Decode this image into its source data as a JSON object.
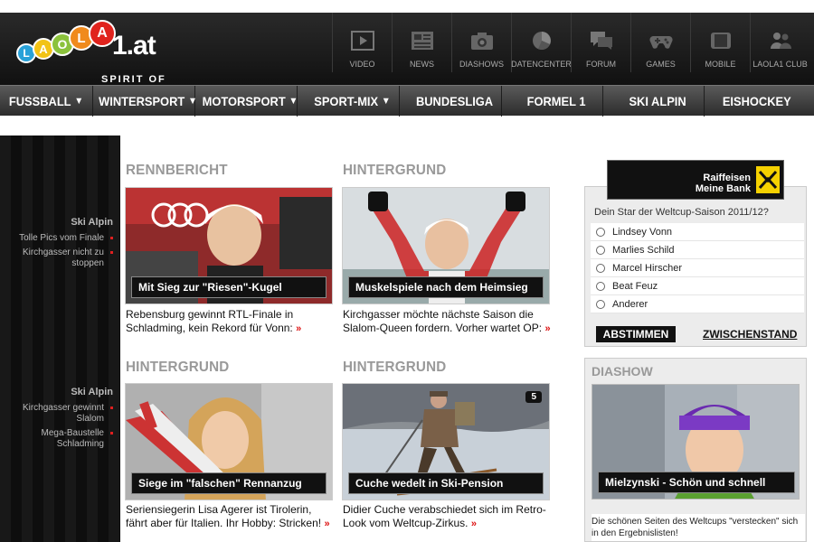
{
  "logo": {
    "balls": [
      "L",
      "A",
      "O",
      "L",
      "A"
    ],
    "suffix": "1.at",
    "tagline": "SPIRIT OF SPORTS"
  },
  "topnav": [
    {
      "label": "VIDEO",
      "icon": "video-icon"
    },
    {
      "label": "NEWS",
      "icon": "news-icon"
    },
    {
      "label": "DIASHOWS",
      "icon": "camera-icon"
    },
    {
      "label": "DATENCENTER",
      "icon": "pie-chart-icon"
    },
    {
      "label": "FORUM",
      "icon": "chat-icon"
    },
    {
      "label": "GAMES",
      "icon": "gamepad-icon"
    },
    {
      "label": "MOBILE",
      "icon": "mobile-icon"
    },
    {
      "label": "LAOLA1 CLUB",
      "icon": "users-icon"
    }
  ],
  "mainnav": [
    {
      "label": "FUSSBALL",
      "dropdown": true
    },
    {
      "label": "WINTERSPORT",
      "dropdown": true
    },
    {
      "label": "MOTORSPORT",
      "dropdown": true
    },
    {
      "label": "SPORT-MIX",
      "dropdown": true
    },
    {
      "label": "BUNDESLIGA",
      "dropdown": false
    },
    {
      "label": "FORMEL 1",
      "dropdown": false
    },
    {
      "label": "SKI ALPIN",
      "dropdown": false
    },
    {
      "label": "EISHOCKEY",
      "dropdown": false
    }
  ],
  "sidebar": {
    "group1": {
      "title": "Ski Alpin",
      "links": [
        "Tolle Pics vom Finale",
        "Kirchgasser nicht zu stoppen"
      ]
    },
    "group2": {
      "title": "Ski Alpin",
      "links": [
        "Kirchgasser gewinnt Slalom",
        "Mega-Baustelle Schladming"
      ]
    }
  },
  "articles": [
    {
      "section": "RENNBERICHT",
      "caption": "Mit Sieg zur \"Riesen\"-Kugel",
      "teaser": "Rebensburg gewinnt RTL-Finale in Schladming, kein Rekord für Vonn:",
      "more": "»"
    },
    {
      "section": "HINTERGRUND",
      "caption": "Muskelspiele nach dem Heimsieg",
      "teaser": "Kirchgasser möchte nächste Saison die Slalom-Queen fordern. Vorher wartet OP:",
      "more": "»"
    },
    {
      "section": "HINTERGRUND",
      "caption": "Siege im \"falschen\" Rennanzug",
      "teaser": "Seriensiegerin Lisa Agerer ist Tirolerin, fährt aber für Italien. Ihr Hobby: Stricken!",
      "more": "»"
    },
    {
      "section": "HINTERGRUND",
      "caption": "Cuche wedelt in Ski-Pension",
      "teaser": "Didier Cuche verabschiedet sich im Retro-Look vom Weltcup-Zirkus.",
      "more": "»",
      "badge": "5"
    }
  ],
  "sponsor": {
    "line1": "Raiffeisen",
    "line2": "Meine Bank"
  },
  "poll": {
    "question": "Dein Star der Weltcup-Saison 2011/12?",
    "options": [
      "Lindsey Vonn",
      "Marlies Schild",
      "Marcel Hirscher",
      "Beat Feuz",
      "Anderer"
    ],
    "vote_label": "ABSTIMMEN",
    "results_label": "ZWISCHENSTAND"
  },
  "diashow": {
    "title": "DIASHOW",
    "caption": "Mielzynski - Schön und schnell",
    "text": "Die schönen Seiten des Weltcups \"verstecken\" sich in den Ergebnislisten!"
  }
}
